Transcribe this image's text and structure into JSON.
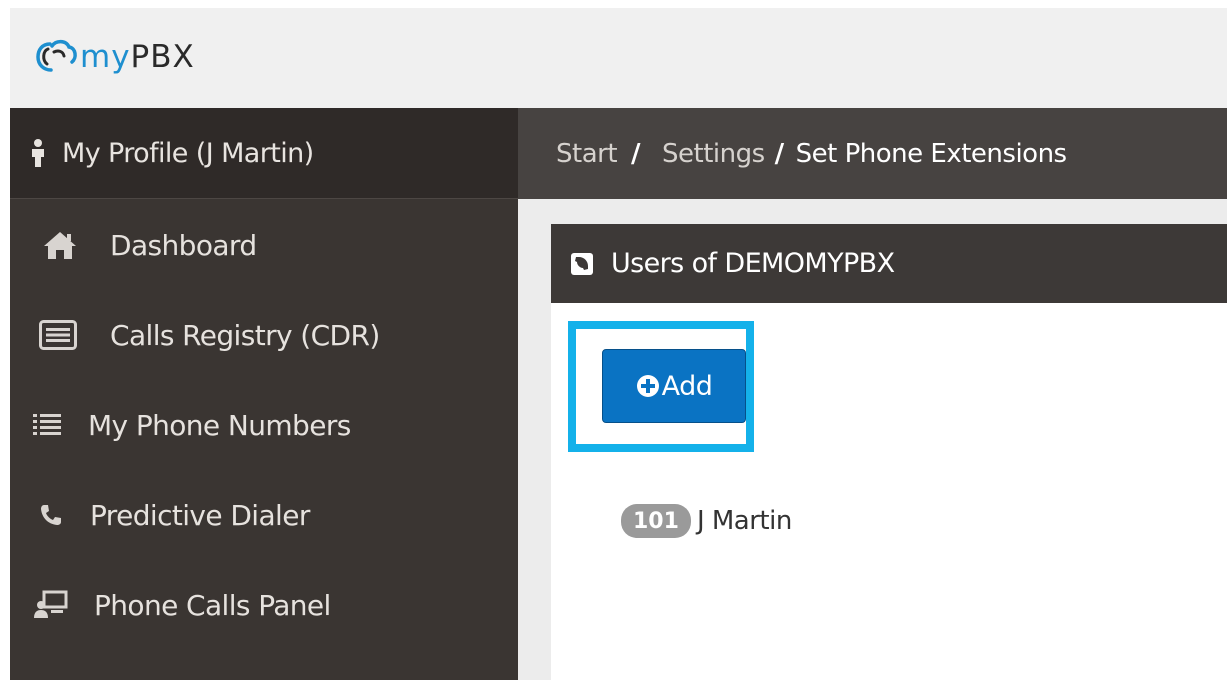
{
  "header": {
    "logo_my": "my",
    "logo_pbx": "PBX"
  },
  "sidebar": {
    "profile_label": "My Profile (J Martin)",
    "items": [
      {
        "label": "Dashboard",
        "icon": "home-icon"
      },
      {
        "label": "Calls Registry (CDR)",
        "icon": "list-card-icon"
      },
      {
        "label": "My Phone Numbers",
        "icon": "numbered-list-icon"
      },
      {
        "label": "Predictive Dialer",
        "icon": "phone-icon"
      },
      {
        "label": "Phone Calls Panel",
        "icon": "users-screen-icon"
      }
    ]
  },
  "breadcrumb": {
    "start": "Start",
    "settings": "Settings",
    "current": "Set Phone Extensions",
    "separator": "/"
  },
  "panel": {
    "title": "Users of DEMOMYPBX",
    "icon": "phone-square-icon",
    "add_label": "Add"
  },
  "users": [
    {
      "extension": "101",
      "name": "J Martin"
    }
  ],
  "colors": {
    "sidebar_bg": "#3a3532",
    "breadcrumb_bg": "#474341",
    "panel_header_bg": "#3d3937",
    "add_button_bg": "#0a73c3",
    "highlight_border": "#14b1ea",
    "brand_blue": "#1e8fcf",
    "badge_bg": "#9a9a9a"
  }
}
